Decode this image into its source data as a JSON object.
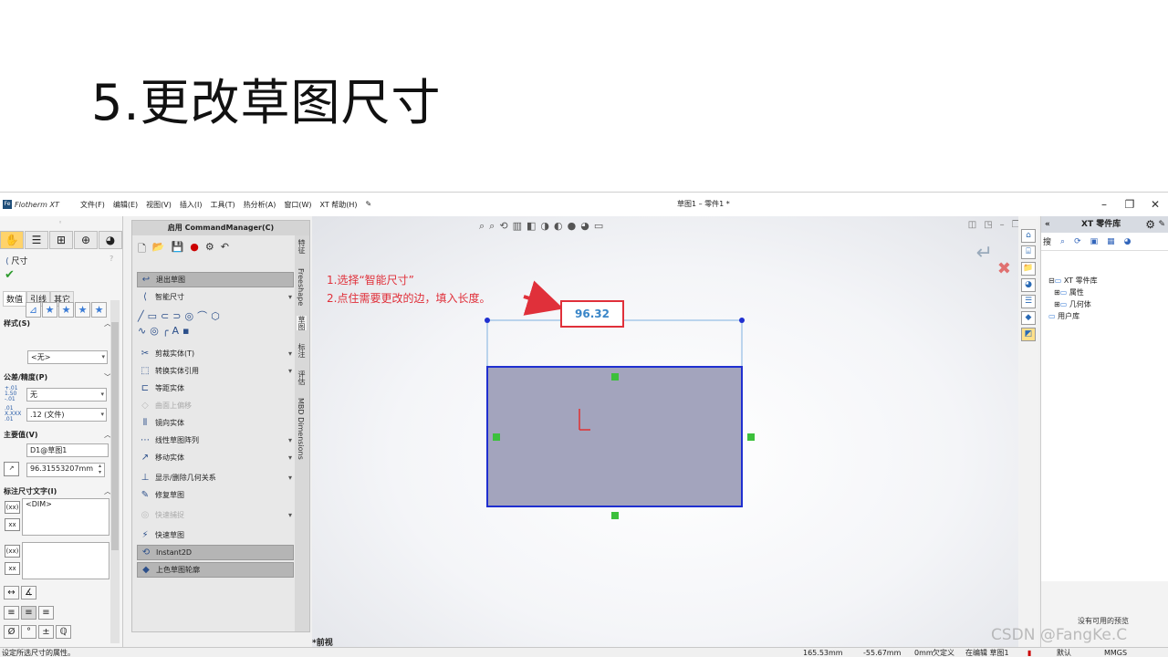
{
  "slide": {
    "title": "5.更改草图尺寸"
  },
  "app": {
    "name": "Flotherm XT",
    "logo": "Fe",
    "menu": [
      "文件(F)",
      "编辑(E)",
      "视图(V)",
      "插入(I)",
      "工具(T)",
      "热分析(A)",
      "窗口(W)",
      "XT 帮助(H)"
    ],
    "document_title": "草图1 – 零件1 *"
  },
  "property_manager": {
    "title": "尺寸",
    "subtabs": [
      "数值",
      "引线",
      "其它"
    ],
    "style_section": "样式(S)",
    "style_value": "<无>",
    "tolerance_section": "公差/精度(P)",
    "tolerance_type": "无",
    "precision_value": ".12 (文件)",
    "tol_icon_1": "+.01\n1.50\n-.01",
    "tol_icon_2": ".01\nX.XXX\n.01",
    "primary_section": "主要值(V)",
    "dimension_name": "D1@草图1",
    "dimension_value": "96.31553207mm",
    "dim_text_section": "标注尺寸文字(I)",
    "dim_text_value": "<DIM>",
    "xx_icon": "(xx)"
  },
  "command_manager": {
    "header": "启用 CommandManager(C)",
    "items": {
      "exit_sketch": "退出草图",
      "smart_dimension": "智能尺寸",
      "trim": "剪裁实体(T)",
      "convert": "转换实体引用",
      "offset": "等距实体",
      "surface_offset": "曲面上偏移",
      "mirror": "镜向实体",
      "linear_pattern": "线性草图阵列",
      "move": "移动实体",
      "relations": "显示/删除几何关系",
      "repair": "修复草图",
      "quick_snap": "快速捕捉",
      "rapid_sketch": "快速草图",
      "instant2d": "Instant2D",
      "shaded_contours": "上色草图轮廓"
    },
    "vertical_tabs": [
      "特征",
      "Freeshape",
      "草图",
      "标注",
      "评估",
      "MBD Dimensions"
    ]
  },
  "viewport": {
    "instructions": [
      "1.选择“智能尺寸”",
      "2.点住需要更改的边，填入长度。"
    ],
    "dimension_display": "96.32",
    "view_name": "*前视"
  },
  "right_panel": {
    "title": "XT 零件库",
    "search_tab": "搜",
    "tree": [
      "XT 零件库",
      "属性",
      "几何体",
      "用户库"
    ],
    "no_preview": "没有可用的预览"
  },
  "status_bar": {
    "hint": "设定所选尺寸的属性。",
    "x": "165.53mm",
    "y": "-55.67mm",
    "z": "0mm",
    "state": "欠定义",
    "mode": "在编辑 草图1",
    "units_default": "默认",
    "units": "MMGS"
  },
  "watermark": "CSDN @FangKe.C",
  "colors": {
    "annotation_red": "#e0303a",
    "dimension_blue": "#3a86c8",
    "sketch_fill": "#a3a4bd",
    "sketch_edge": "#1f2fd0"
  }
}
